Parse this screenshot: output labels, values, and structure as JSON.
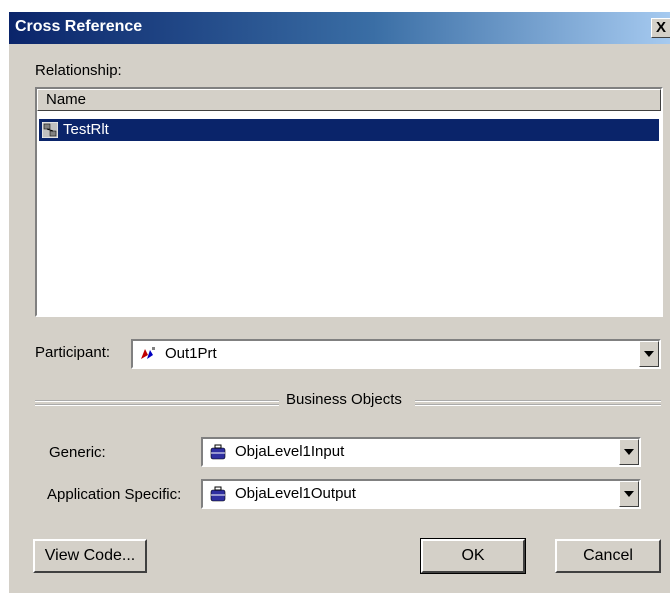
{
  "window": {
    "title": "Cross Reference",
    "close_label": "X"
  },
  "relationship": {
    "label": "Relationship:",
    "column_header": "Name",
    "items": [
      {
        "label": "TestRlt",
        "selected": true,
        "icon": "relationship-icon"
      }
    ]
  },
  "participant": {
    "label": "Participant:",
    "value": "Out1Prt",
    "icon": "participant-icon"
  },
  "business_objects": {
    "group_label": "Business Objects",
    "generic": {
      "label": "Generic:",
      "value": "ObjaLevel1Input",
      "icon": "business-object-icon"
    },
    "app_specific": {
      "label": "Application Specific:",
      "value": "ObjaLevel1Output",
      "icon": "business-object-icon"
    }
  },
  "buttons": {
    "view_code": "View Code...",
    "ok": "OK",
    "cancel": "Cancel"
  },
  "colors": {
    "face": "#d4d0c8",
    "title_start": "#0a246a",
    "selection": "#0a246a"
  }
}
